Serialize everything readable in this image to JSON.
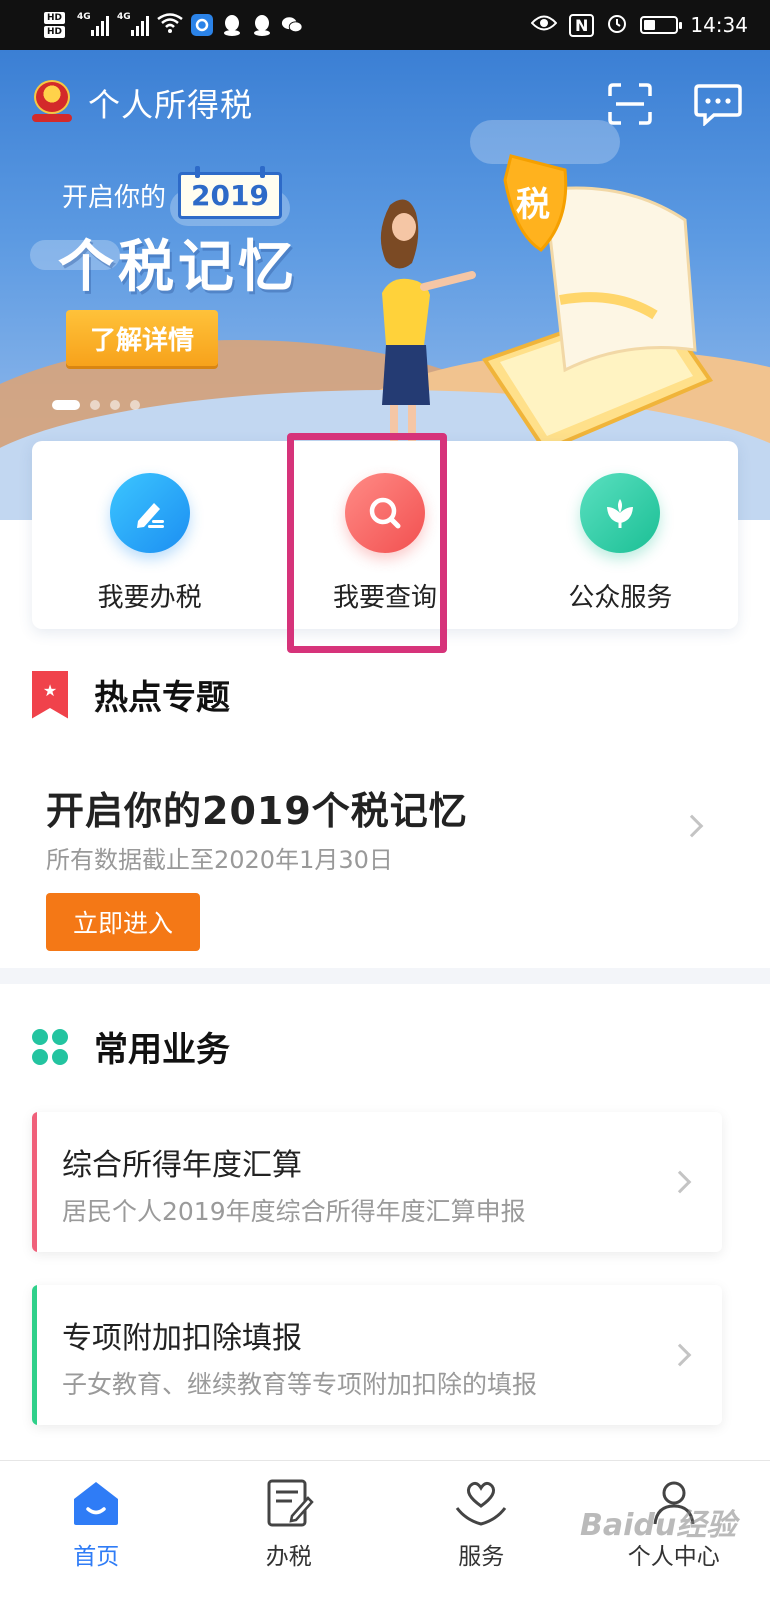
{
  "status_bar": {
    "left_icons": [
      "hd-icon",
      "signal-4g-icon",
      "signal-4g-icon",
      "wifi-icon",
      "browser-app-icon",
      "qq-icon",
      "qq-icon",
      "wechat-icon"
    ],
    "network_tag_1": "4G",
    "network_tag_2": "4G",
    "right_icons": [
      "eye-icon",
      "nfc-icon",
      "alarm-icon",
      "battery-icon"
    ],
    "nfc_label": "N",
    "time": "14:34",
    "battery_level": 0.35
  },
  "header": {
    "app_title": "个人所得税",
    "logo_icon": "tax-emblem-icon",
    "scan_icon": "scan-icon",
    "message_icon": "message-icon"
  },
  "banner": {
    "pre_text": "开启你的",
    "year": "2019",
    "title": "个税记忆",
    "button_label": "了解详情",
    "shield_text": "税",
    "pages_total": 4,
    "active_page": 1
  },
  "quick_actions": [
    {
      "label": "我要办税",
      "icon": "edit-icon",
      "color": "#1c8ef2"
    },
    {
      "label": "我要查询",
      "icon": "search-icon",
      "color": "#f25050"
    },
    {
      "label": "公众服务",
      "icon": "flower-icon",
      "color": "#1bbf95"
    }
  ],
  "hot_topics": {
    "section_title": "热点专题",
    "topic_title": "开启你的2019个税记忆",
    "topic_subtitle": "所有数据截止至2020年1月30日",
    "enter_button": "立即进入"
  },
  "common_business": {
    "section_title": "常用业务",
    "items": [
      {
        "title": "综合所得年度汇算",
        "subtitle": "居民个人2019年度综合所得年度汇算申报",
        "accent": "#f0607a"
      },
      {
        "title": "专项附加扣除填报",
        "subtitle": "子女教育、继续教育等专项附加扣除的填报",
        "accent": "#2fd08a"
      }
    ]
  },
  "tab_bar": {
    "tabs": [
      {
        "label": "首页",
        "icon": "home-icon"
      },
      {
        "label": "办税",
        "icon": "document-edit-icon"
      },
      {
        "label": "服务",
        "icon": "heart-hand-icon"
      },
      {
        "label": "个人中心",
        "icon": "user-icon"
      }
    ],
    "active": "首页"
  },
  "watermark": "Baidu经验",
  "colors": {
    "accent_blue": "#2f7cf6",
    "highlight": "#d6337a",
    "orange_button": "#f47816"
  }
}
